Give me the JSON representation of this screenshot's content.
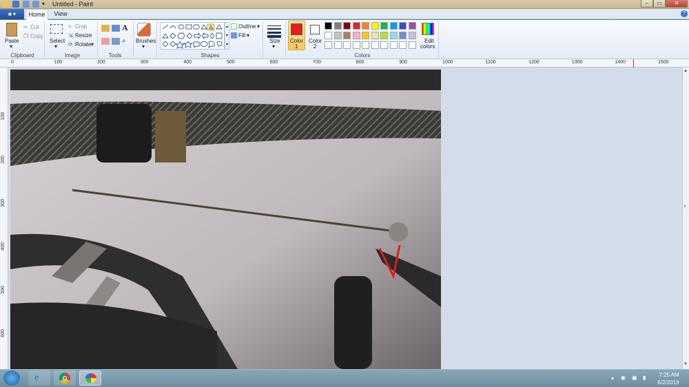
{
  "window": {
    "title": "Untitled - Paint",
    "controls": [
      "–",
      "▭",
      "✕"
    ]
  },
  "tabs": [
    "Home",
    "View"
  ],
  "ribbon": {
    "clipboard": {
      "label": "Clipboard",
      "paste": "Paste",
      "cut": "Cut",
      "copy": "Copy"
    },
    "image": {
      "label": "Image",
      "select": "Select",
      "crop": "Crop",
      "resize": "Resize",
      "rotate": "Rotate"
    },
    "tools": {
      "label": "Tools"
    },
    "brushes": {
      "label": "Brushes"
    },
    "shapes": {
      "label": "Shapes",
      "outline": "Outline",
      "fill": "Fill"
    },
    "size": {
      "label": "Size"
    },
    "color1": {
      "label": "Color",
      "num": "1",
      "color": "#e81c1c"
    },
    "color2": {
      "label": "Color",
      "num": "2",
      "color": "#ffffff"
    },
    "colors": {
      "label": "Colors"
    },
    "edit_colors": {
      "label1": "Edit",
      "label2": "colors"
    },
    "palette_row1": [
      "#000000",
      "#7f7f7f",
      "#880015",
      "#ed1c24",
      "#ff7f27",
      "#fff200",
      "#22b14c",
      "#00a2e8",
      "#3f48cc",
      "#a349a4"
    ],
    "palette_row2": [
      "#ffffff",
      "#c3c3c3",
      "#b97a57",
      "#ffaec9",
      "#ffc90e",
      "#efe4b0",
      "#b5e61d",
      "#99d9ea",
      "#7092be",
      "#c8bfe7"
    ]
  },
  "ruler": {
    "h_ticks": [
      "0",
      "100",
      "200",
      "300",
      "400",
      "500",
      "600",
      "700",
      "800",
      "900",
      "1000",
      "1100",
      "1200",
      "1300",
      "1400",
      "1500"
    ],
    "v_ticks": [
      "100",
      "200",
      "300",
      "400",
      "500",
      "600"
    ]
  },
  "taskbar": {
    "time": "7:25 AM",
    "date": "6/2/2019",
    "apps": [
      "start-orb",
      "internet-explorer-icon",
      "chrome-icon",
      "paint-icon"
    ]
  }
}
